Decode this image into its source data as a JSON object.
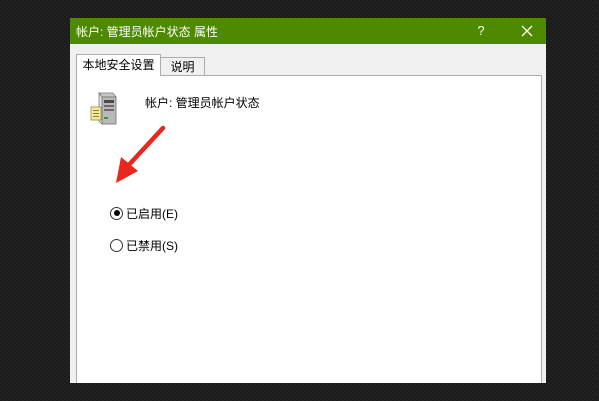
{
  "window": {
    "title": "帐户: 管理员帐户状态 属性",
    "help_label": "?",
    "accent_color": "#4d8a00"
  },
  "tabs": [
    {
      "label": "本地安全设置",
      "selected": true
    },
    {
      "label": "说明",
      "selected": false
    }
  ],
  "panel": {
    "icon": "server-icon",
    "header_label": "帐户: 管理员帐户状态",
    "options": [
      {
        "label": "已启用(E)",
        "checked": true
      },
      {
        "label": "已禁用(S)",
        "checked": false
      }
    ]
  },
  "annotation": {
    "arrow_color": "#e8281e",
    "points_to": "已启用(E)"
  }
}
